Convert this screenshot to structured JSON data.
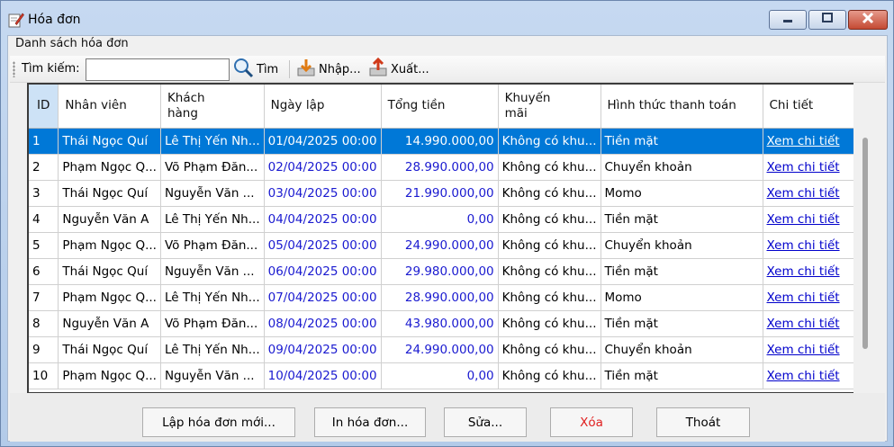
{
  "window": {
    "title": "Hóa đơn"
  },
  "group": {
    "label": "Danh sách hóa đơn"
  },
  "toolbar": {
    "search_label": "Tìm kiếm:",
    "search_value": "",
    "find_label": "Tìm",
    "import_label": "Nhập...",
    "export_label": "Xuất..."
  },
  "table": {
    "columns": [
      "ID",
      "Nhân viên",
      "Khách\nhàng",
      "Ngày lập",
      "Tổng tiền",
      "Khuyến\nmãi",
      "Hình thức thanh toán",
      "Chi tiết"
    ],
    "rows": [
      [
        "1",
        "Thái Ngọc Quí",
        "Lê Thị Yến Nh...",
        "01/04/2025 00:00",
        "14.990.000,00",
        "Không có khu...",
        "Tiền mặt",
        "Xem chi tiết"
      ],
      [
        "2",
        "Phạm Ngọc Q...",
        "Võ Phạm Đăn...",
        "02/04/2025 00:00",
        "28.990.000,00",
        "Không có khu...",
        "Chuyển khoản",
        "Xem chi tiết"
      ],
      [
        "3",
        "Thái Ngọc Quí",
        "Nguyễn Văn ...",
        "03/04/2025 00:00",
        "21.990.000,00",
        "Không có khu...",
        "Momo",
        "Xem chi tiết"
      ],
      [
        "4",
        "Nguyễn Văn A",
        "Lê Thị Yến Nh...",
        "04/04/2025 00:00",
        "0,00",
        "Không có khu...",
        "Tiền mặt",
        "Xem chi tiết"
      ],
      [
        "5",
        "Phạm Ngọc Q...",
        "Võ Phạm Đăn...",
        "05/04/2025 00:00",
        "24.990.000,00",
        "Không có khu...",
        "Chuyển khoản",
        "Xem chi tiết"
      ],
      [
        "6",
        "Thái Ngọc Quí",
        "Nguyễn Văn ...",
        "06/04/2025 00:00",
        "29.980.000,00",
        "Không có khu...",
        "Tiền mặt",
        "Xem chi tiết"
      ],
      [
        "7",
        "Phạm Ngọc Q...",
        "Lê Thị Yến Nh...",
        "07/04/2025 00:00",
        "28.990.000,00",
        "Không có khu...",
        "Momo",
        "Xem chi tiết"
      ],
      [
        "8",
        "Nguyễn Văn A",
        "Võ Phạm Đăn...",
        "08/04/2025 00:00",
        "43.980.000,00",
        "Không có khu...",
        "Tiền mặt",
        "Xem chi tiết"
      ],
      [
        "9",
        "Thái Ngọc Quí",
        "Lê Thị Yến Nh...",
        "09/04/2025 00:00",
        "24.990.000,00",
        "Không có khu...",
        "Chuyển khoản",
        "Xem chi tiết"
      ],
      [
        "10",
        "Phạm Ngọc Q...",
        "Nguyễn Văn ...",
        "10/04/2025 00:00",
        "0,00",
        "Không có khu...",
        "Tiền mặt",
        "Xem chi tiết"
      ]
    ],
    "selected_row": 0
  },
  "buttons": {
    "new_invoice": "Lập hóa đơn mới...",
    "print_invoice": "In hóa đơn...",
    "edit": "Sửa...",
    "delete": "Xóa",
    "exit": "Thoát"
  },
  "colors": {
    "selection": "#0078d7",
    "link": "#0000cc",
    "delete_text": "#e02020"
  }
}
